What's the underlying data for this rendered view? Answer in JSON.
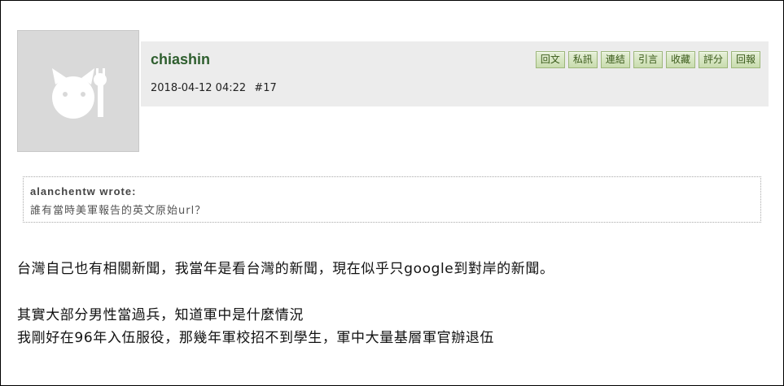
{
  "post": {
    "username": "chiashin",
    "date": "2018-04-12 04:22",
    "post_number": "#17",
    "actions": [
      "回文",
      "私訊",
      "連結",
      "引言",
      "收藏",
      "評分",
      "回報"
    ],
    "quote": {
      "author": "alanchentw wrote:",
      "text": "誰有當時美軍報告的英文原始url？"
    },
    "body_lines": [
      "台灣自己也有相關新聞，我當年是看台灣的新聞，現在似乎只google到對岸的新聞。",
      "其實大部分男性當過兵，知道軍中是什麼情況",
      "我剛好在96年入伍服役，那幾年軍校招不到學生，軍中大量基層軍官辦退伍"
    ]
  },
  "colors": {
    "header_bg": "#ececec",
    "username": "#2e5e2e",
    "button_bg": "#c9dcae",
    "avatar_bg": "#d9d9d9"
  },
  "icons": {
    "avatar": "default-avatar-icon"
  }
}
